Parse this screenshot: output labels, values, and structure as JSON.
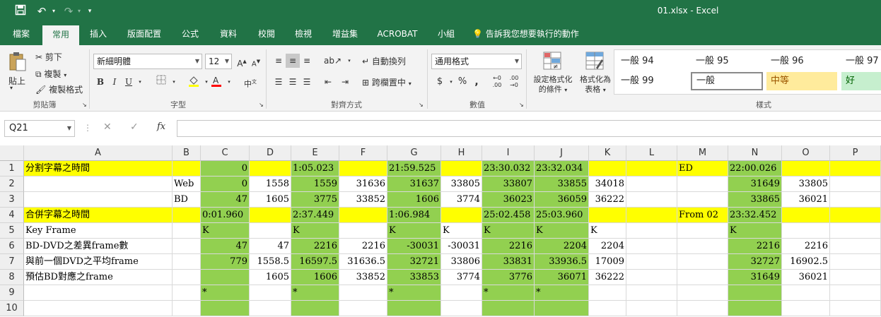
{
  "window": {
    "title": "01.xlsx  -  Excel",
    "quick_access": {
      "save_icon": "save-icon",
      "undo_icon": "undo-icon",
      "redo_icon": "redo-icon",
      "customize_icon": "dropdown-icon"
    }
  },
  "menu": {
    "tabs": [
      "檔案",
      "常用",
      "插入",
      "版面配置",
      "公式",
      "資料",
      "校閱",
      "檢視",
      "增益集",
      "ACROBAT",
      "小組"
    ],
    "active_index": 1,
    "tell_me": "告訴我您想要執行的動作"
  },
  "ribbon": {
    "clipboard": {
      "paste": "貼上",
      "cut": "剪下",
      "copy": "複製",
      "format_painter": "複製格式",
      "label": "剪貼簿"
    },
    "font": {
      "name": "新細明體",
      "size": "12",
      "bold": "B",
      "italic": "I",
      "underline": "U",
      "label": "字型"
    },
    "alignment": {
      "wrap": "自動換列",
      "merge": "跨欄置中",
      "label": "對齊方式"
    },
    "number": {
      "format": "通用格式",
      "currency": "$",
      "percent": "%",
      "comma": ",",
      "label": "數值"
    },
    "styles_group": {
      "conditional": "設定格式化的條件",
      "table": "格式化為表格",
      "label": "樣式"
    },
    "style_gallery": [
      "一般 94",
      "一般 95",
      "一般 96",
      "一般 97",
      "一般 99",
      "一般",
      "中等",
      "好"
    ]
  },
  "formula_bar": {
    "name_box": "Q21",
    "fx": "fx",
    "content": ""
  },
  "sheet": {
    "columns": [
      "A",
      "B",
      "C",
      "D",
      "E",
      "F",
      "G",
      "H",
      "I",
      "J",
      "K",
      "L",
      "M",
      "N",
      "O",
      "P"
    ],
    "rows": [
      "1",
      "2",
      "3",
      "4",
      "5",
      "6",
      "7",
      "8",
      "9",
      "10"
    ],
    "cells": {
      "r1": {
        "A": "分割字幕之時間",
        "C": "0",
        "E": "1:05.023",
        "G": "21:59.525",
        "I": "23:30.032",
        "J": "23:32.034",
        "M": "ED",
        "N": "22:00.026"
      },
      "r2": {
        "B": "Web",
        "C": "0",
        "D": "1558",
        "E": "1559",
        "F": "31636",
        "G": "31637",
        "H": "33805",
        "I": "33807",
        "J": "33855",
        "K": "34018",
        "N": "31649",
        "O": "33805"
      },
      "r3": {
        "B": "BD",
        "C": "47",
        "D": "1605",
        "E": "3775",
        "F": "33852",
        "G": "1606",
        "H": "3774",
        "I": "36023",
        "J": "36059",
        "K": "36222",
        "N": "33865",
        "O": "36021"
      },
      "r4": {
        "A": "合併字幕之時間",
        "C": "0:01.960",
        "E": "2:37.449",
        "G": "1:06.984",
        "I": "25:02.458",
        "J": "25:03.960",
        "M": "From 02",
        "N": "23:32.452"
      },
      "r5": {
        "A": "Key Frame",
        "C": "K",
        "E": "K",
        "G": "K",
        "H": "K",
        "I": "K",
        "J": "K",
        "K": "K",
        "N": "K"
      },
      "r6": {
        "A": "BD-DVD之差異frame數",
        "C": "47",
        "D": "47",
        "E": "2216",
        "F": "2216",
        "G": "-30031",
        "H": "-30031",
        "I": "2216",
        "J": "2204",
        "K": "2204",
        "N": "2216",
        "O": "2216"
      },
      "r7": {
        "A": "與前一個DVD之平均frame",
        "C": "779",
        "D": "1558.5",
        "E": "16597.5",
        "F": "31636.5",
        "G": "32721",
        "H": "33806",
        "I": "33831",
        "J": "33936.5",
        "K": "17009",
        "N": "32727",
        "O": "16902.5"
      },
      "r8": {
        "A": "預估BD對應之frame",
        "D": "1605",
        "E": "1606",
        "F": "33852",
        "G": "33853",
        "H": "3774",
        "I": "3776",
        "J": "36071",
        "K": "36222",
        "N": "31649",
        "O": "36021"
      },
      "r9": {
        "C": "*",
        "E": "*",
        "G": "*",
        "I": "*",
        "J": "*"
      },
      "r10": {}
    }
  },
  "colors": {
    "excel_green": "#217346",
    "highlight_yellow": "#ffff00",
    "cell_green": "#92d050",
    "style_neutral": "#ffeb9c",
    "style_good": "#c6efce"
  }
}
